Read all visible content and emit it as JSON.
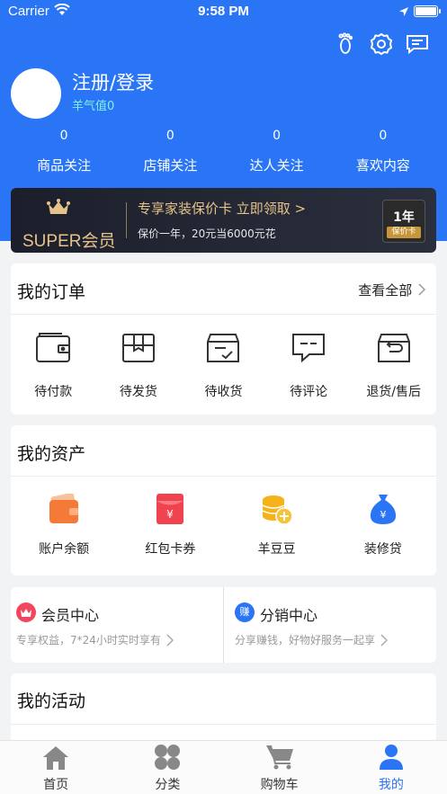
{
  "status_bar": {
    "carrier": "Carrier",
    "time": "9:58 PM"
  },
  "profile": {
    "login_label": "注册/登录",
    "sheep_value": "羊气值0"
  },
  "stats": [
    {
      "count": "0",
      "label": "商品关注"
    },
    {
      "count": "0",
      "label": "店铺关注"
    },
    {
      "count": "0",
      "label": "达人关注"
    },
    {
      "count": "0",
      "label": "喜欢内容"
    }
  ],
  "vip": {
    "brand": "SUPER会员",
    "title": "专享家装保价卡  立即领取 >",
    "subtitle": "保价一年，20元当6000元花",
    "card_year": "1年",
    "card_tag": "保价卡"
  },
  "orders": {
    "title": "我的订单",
    "see_all": "查看全部",
    "items": [
      {
        "label": "待付款",
        "icon": "wallet-icon"
      },
      {
        "label": "待发货",
        "icon": "box-icon"
      },
      {
        "label": "待收货",
        "icon": "receive-icon"
      },
      {
        "label": "待评论",
        "icon": "comment-icon"
      },
      {
        "label": "退货/售后",
        "icon": "return-icon"
      }
    ]
  },
  "assets": {
    "title": "我的资产",
    "items": [
      {
        "label": "账户余额",
        "icon": "balance-icon"
      },
      {
        "label": "红包卡券",
        "icon": "redpacket-icon"
      },
      {
        "label": "羊豆豆",
        "icon": "coins-icon"
      },
      {
        "label": "装修贷",
        "icon": "loan-icon"
      }
    ]
  },
  "centers": [
    {
      "title": "会员中心",
      "desc": "专享权益，7*24小时实时享有",
      "badge": "",
      "color": "#f0475e"
    },
    {
      "title": "分销中心",
      "desc": "分享赚钱，好物好服务一起享",
      "badge": "赚",
      "color": "#2a74f6"
    }
  ],
  "activity": {
    "title": "我的活动"
  },
  "tabs": [
    {
      "label": "首页",
      "icon": "home-icon"
    },
    {
      "label": "分类",
      "icon": "category-icon"
    },
    {
      "label": "购物车",
      "icon": "cart-icon"
    },
    {
      "label": "我的",
      "icon": "profile-icon",
      "active": true
    }
  ],
  "colors": {
    "primary": "#2a74f6",
    "gold": "#e6c38a",
    "accent_cyan": "#7ef2f8"
  }
}
